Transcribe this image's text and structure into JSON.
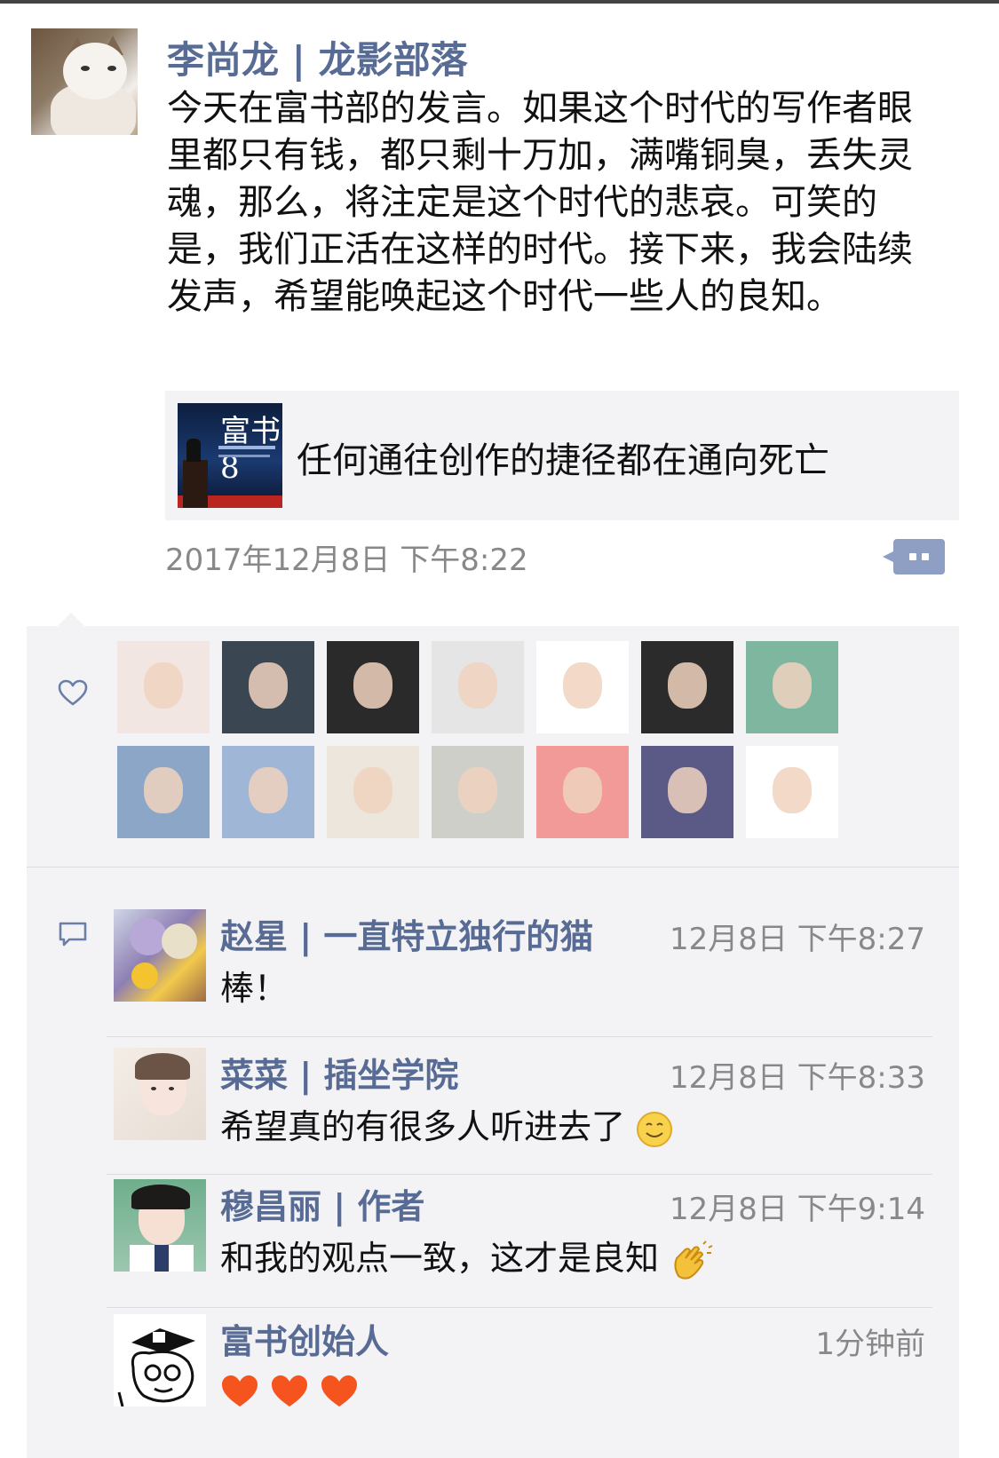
{
  "post": {
    "author": "李尚龙 | 龙影部落",
    "text": "今天在富书部的发言。如果这个时代的写作者眼里都只有钱，都只剩十万加，满嘴铜臭，丢失灵魂，那么，将注定是这个时代的悲哀。可笑的是，我们正活在这样的时代。接下来，我会陆续发声，希望能唤起这个时代一些人的良知。",
    "link_title": "任何通往创作的捷径都在通向死亡",
    "link_thumb_text": "富书8",
    "time": "2017年12月8日 下午8:22"
  },
  "likes": {
    "icon": "heart-outline-icon",
    "avatars": [
      {
        "name": "like-avatar-1",
        "color": "#f1e6e2"
      },
      {
        "name": "like-avatar-2",
        "color": "#3a4652"
      },
      {
        "name": "like-avatar-3",
        "color": "#2a2a2a"
      },
      {
        "name": "like-avatar-4",
        "color": "#e5e5e5"
      },
      {
        "name": "like-avatar-5",
        "color": "#ffffff"
      },
      {
        "name": "like-avatar-6",
        "color": "#2b2b2b"
      },
      {
        "name": "like-avatar-7",
        "color": "#7fb6a0"
      },
      {
        "name": "like-avatar-8",
        "color": "#8ca6c8"
      },
      {
        "name": "like-avatar-9",
        "color": "#9fb6d6"
      },
      {
        "name": "like-avatar-10",
        "color": "#ece6dc"
      },
      {
        "name": "like-avatar-11",
        "color": "#cfcfc9"
      },
      {
        "name": "like-avatar-12",
        "color": "#f29a98"
      },
      {
        "name": "like-avatar-13",
        "color": "#5b5a86"
      },
      {
        "name": "like-avatar-14",
        "color": "#ffffff"
      }
    ]
  },
  "comments": [
    {
      "name": "赵星 | 一直特立独行的猫",
      "time": "12月8日 下午8:27",
      "text": "棒！",
      "emoji": ""
    },
    {
      "name": "菜菜 | 插坐学院",
      "time": "12月8日 下午8:33",
      "text": "希望真的有很多人听进去了",
      "emoji": "smile"
    },
    {
      "name": "穆昌丽 | 作者",
      "time": "12月8日 下午9:14",
      "text": "和我的观点一致，这才是良知",
      "emoji": "clap"
    },
    {
      "name": "富书创始人",
      "time": "1分钟前",
      "text": "",
      "emoji": "hearts"
    }
  ],
  "colors": {
    "name_blue": "#576b95",
    "panel_bg": "#f3f3f5",
    "more_button": "#8f9fc3"
  }
}
